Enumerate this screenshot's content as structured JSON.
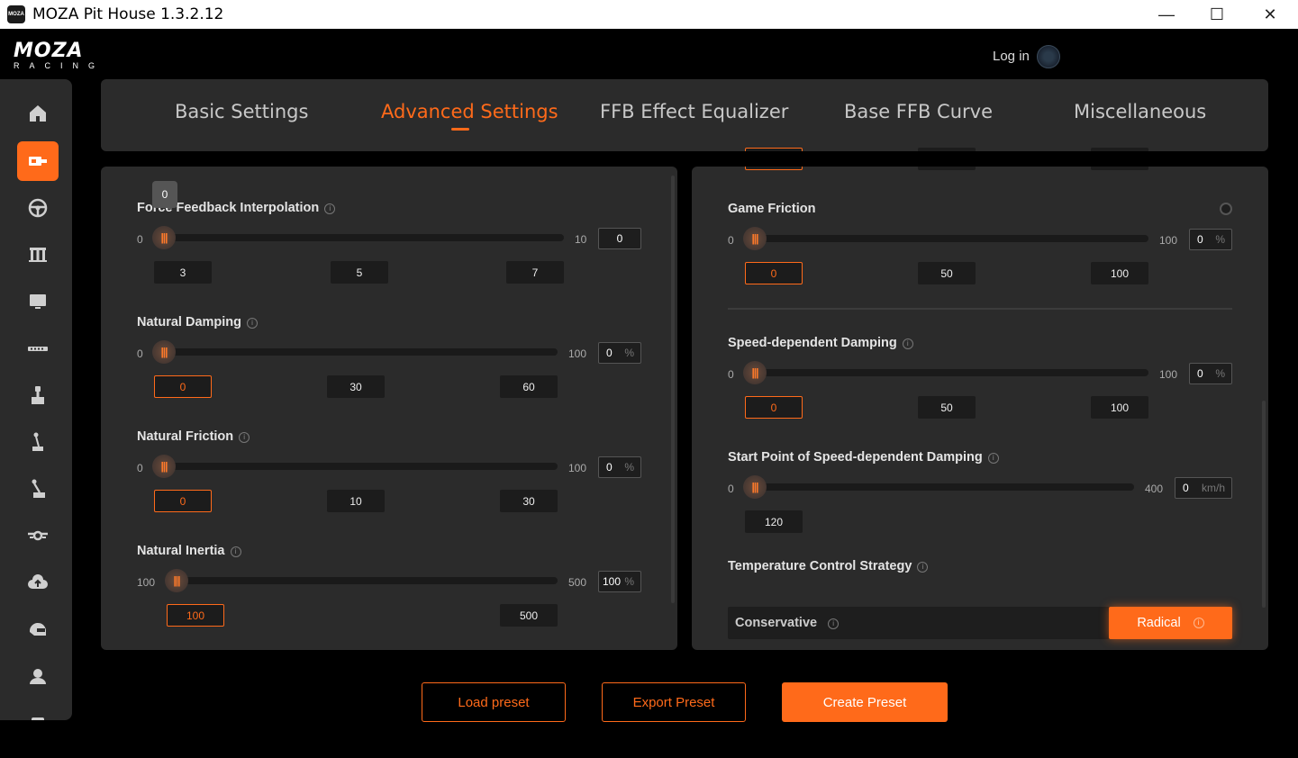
{
  "window": {
    "title": "MOZA Pit House 1.3.2.12"
  },
  "header": {
    "logo_main": "MOZA",
    "logo_sub": "RACING",
    "login_label": "Log in"
  },
  "tabs": [
    {
      "label": "Basic Settings"
    },
    {
      "label": "Advanced Settings"
    },
    {
      "label": "FFB Effect Equalizer"
    },
    {
      "label": "Base FFB Curve"
    },
    {
      "label": "Miscellaneous"
    }
  ],
  "left_panel": {
    "ffb_interpolation": {
      "label": "Force Feedback Interpolation",
      "tooltip": "0",
      "min": "0",
      "max": "10",
      "value": "0",
      "presets": [
        "3",
        "5",
        "7"
      ]
    },
    "natural_damping": {
      "label": "Natural Damping",
      "min": "0",
      "max": "100",
      "value": "0",
      "unit": "%",
      "presets": [
        "0",
        "30",
        "60"
      ]
    },
    "natural_friction": {
      "label": "Natural Friction",
      "min": "0",
      "max": "100",
      "value": "0",
      "unit": "%",
      "presets": [
        "0",
        "10",
        "30"
      ]
    },
    "natural_inertia": {
      "label": "Natural Inertia",
      "min": "100",
      "max": "500",
      "value": "100",
      "unit": "%",
      "presets": [
        "100",
        "500"
      ]
    }
  },
  "right_panel": {
    "game_friction": {
      "label": "Game Friction",
      "min": "0",
      "max": "100",
      "value": "0",
      "unit": "%",
      "presets": [
        "0",
        "50",
        "100"
      ]
    },
    "speed_damping": {
      "label": "Speed-dependent Damping",
      "min": "0",
      "max": "100",
      "value": "0",
      "unit": "%",
      "presets": [
        "0",
        "50",
        "100"
      ]
    },
    "speed_damping_start": {
      "label": "Start Point of Speed-dependent Damping",
      "min": "0",
      "max": "400",
      "value": "0",
      "unit": "km/h",
      "presets": [
        "120"
      ]
    },
    "temperature": {
      "label": "Temperature Control Strategy",
      "options": [
        "Conservative",
        "Radical"
      ],
      "selected": "Radical"
    }
  },
  "footer": {
    "load_label": "Load preset",
    "export_label": "Export Preset",
    "create_label": "Create Preset"
  },
  "colors": {
    "accent": "#ff6a1a",
    "panel": "#2b2b2b",
    "background": "#000000"
  }
}
